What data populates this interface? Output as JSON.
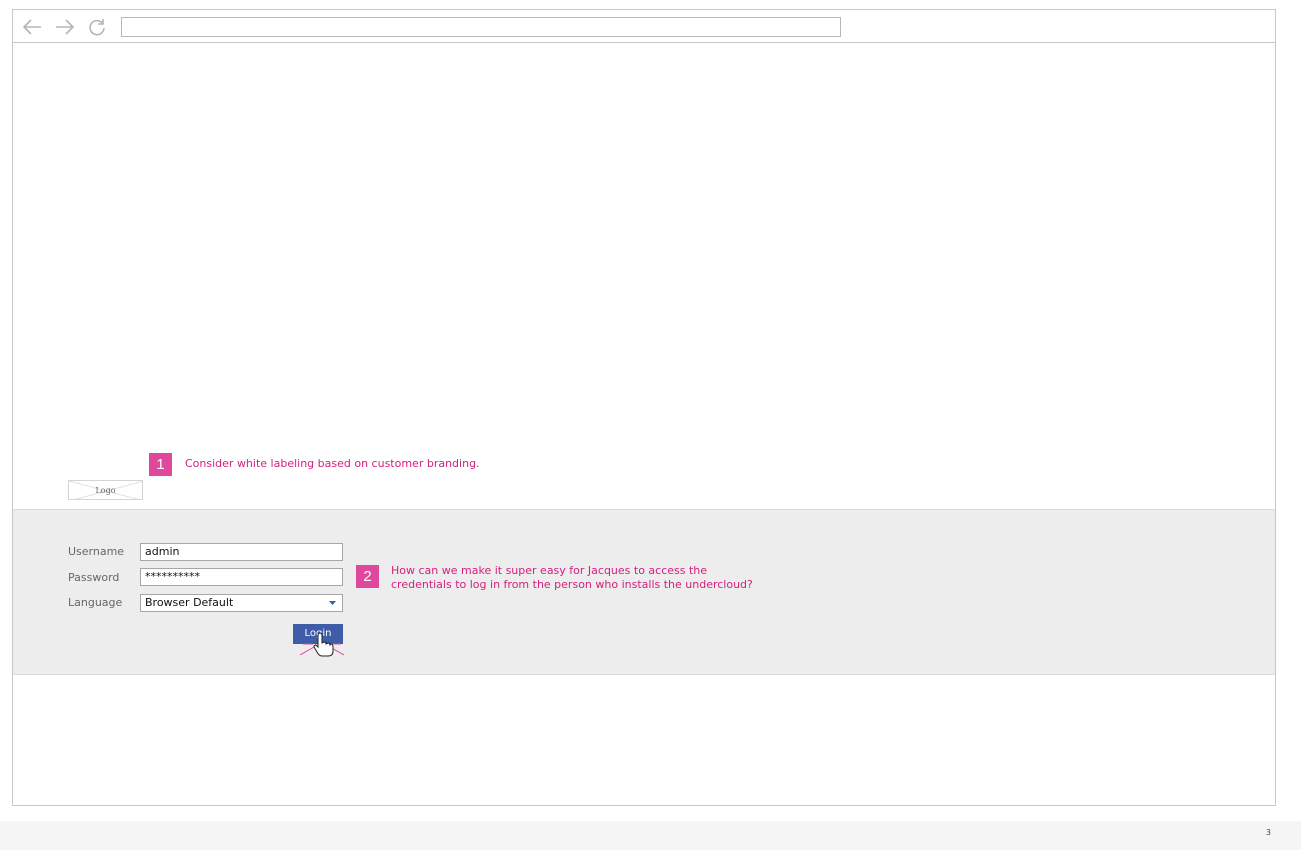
{
  "browser": {
    "address_value": "",
    "icons": [
      "back-arrow-icon",
      "forward-arrow-icon",
      "reload-icon"
    ]
  },
  "logo": {
    "label": "Logo"
  },
  "notes": [
    {
      "number": "1",
      "text": "Consider white labeling based on customer branding."
    },
    {
      "number": "2",
      "lines": [
        "How can we make it super easy for Jacques to access the",
        "credentials to log in from the person who installs the undercloud?"
      ]
    }
  ],
  "login_form": {
    "username_label": "Username",
    "username_value": "admin",
    "password_label": "Password",
    "password_value": "**********",
    "language_label": "Language",
    "language_value": "Browser Default",
    "login_label": "Login"
  },
  "footer": {
    "page_number": "3"
  },
  "colors": {
    "annotation": "#d4207e",
    "badge": "#e0489c",
    "button": "#3f5ca8",
    "panel": "#ededed"
  }
}
